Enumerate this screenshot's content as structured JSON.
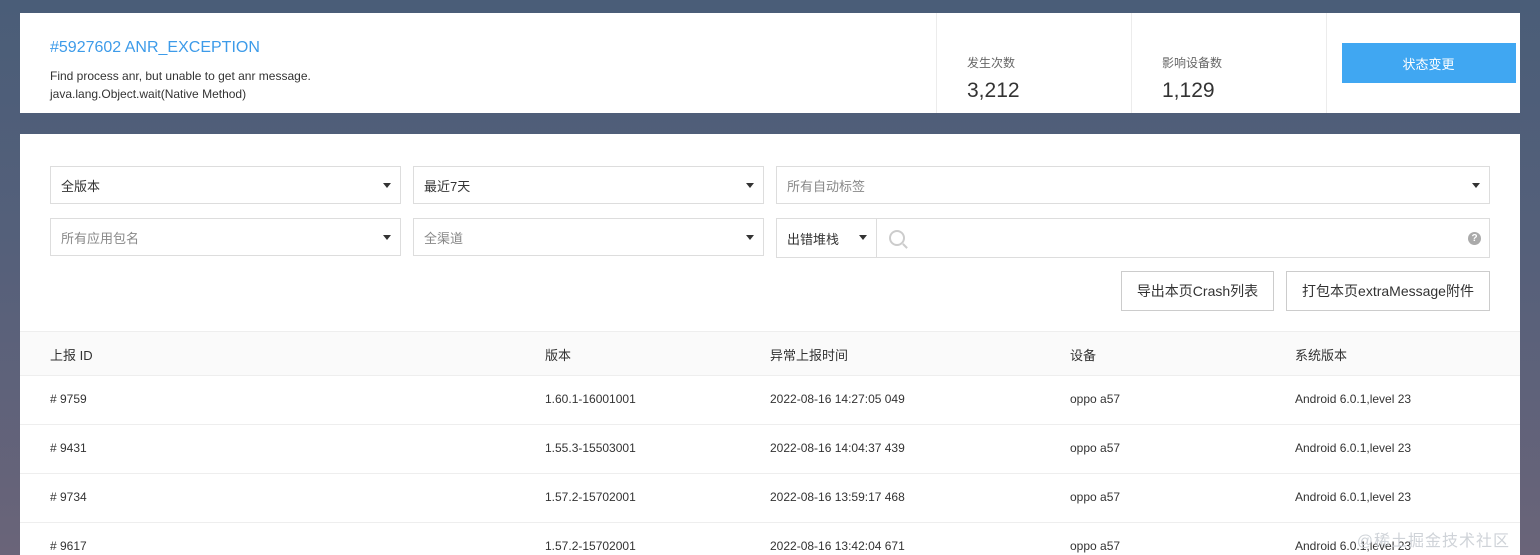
{
  "issue": {
    "title": "#5927602 ANR_EXCEPTION",
    "desc_line1": "Find process anr, but unable to get anr message.",
    "desc_line2": "java.lang.Object.wait(Native Method)"
  },
  "stats": {
    "occurrences_label": "发生次数",
    "occurrences_value": "3,212",
    "devices_label": "影响设备数",
    "devices_value": "1,129"
  },
  "status_button": "状态变更",
  "filters": {
    "version": "全版本",
    "date_range": "最近7天",
    "auto_tags": "所有自动标签",
    "package": "所有应用包名",
    "channel": "全渠道",
    "search_type": "出错堆栈",
    "search_value": "",
    "help": "?"
  },
  "actions": {
    "export": "导出本页Crash列表",
    "pack": "打包本页extraMessage附件"
  },
  "table": {
    "headers": [
      "上报 ID",
      "版本",
      "异常上报时间",
      "设备",
      "系统版本"
    ],
    "rows": [
      [
        "# 9759",
        "1.60.1-16001001",
        "2022-08-16 14:27:05 049",
        "oppo a57",
        "Android 6.0.1,level 23"
      ],
      [
        "# 9431",
        "1.55.3-15503001",
        "2022-08-16 14:04:37 439",
        "oppo a57",
        "Android 6.0.1,level 23"
      ],
      [
        "# 9734",
        "1.57.2-15702001",
        "2022-08-16 13:59:17 468",
        "oppo a57",
        "Android 6.0.1,level 23"
      ],
      [
        "# 9617",
        "1.57.2-15702001",
        "2022-08-16 13:42:04 671",
        "oppo a57",
        "Android 6.0.1,level 23"
      ]
    ]
  },
  "watermark": "@稀土掘金技术社区"
}
